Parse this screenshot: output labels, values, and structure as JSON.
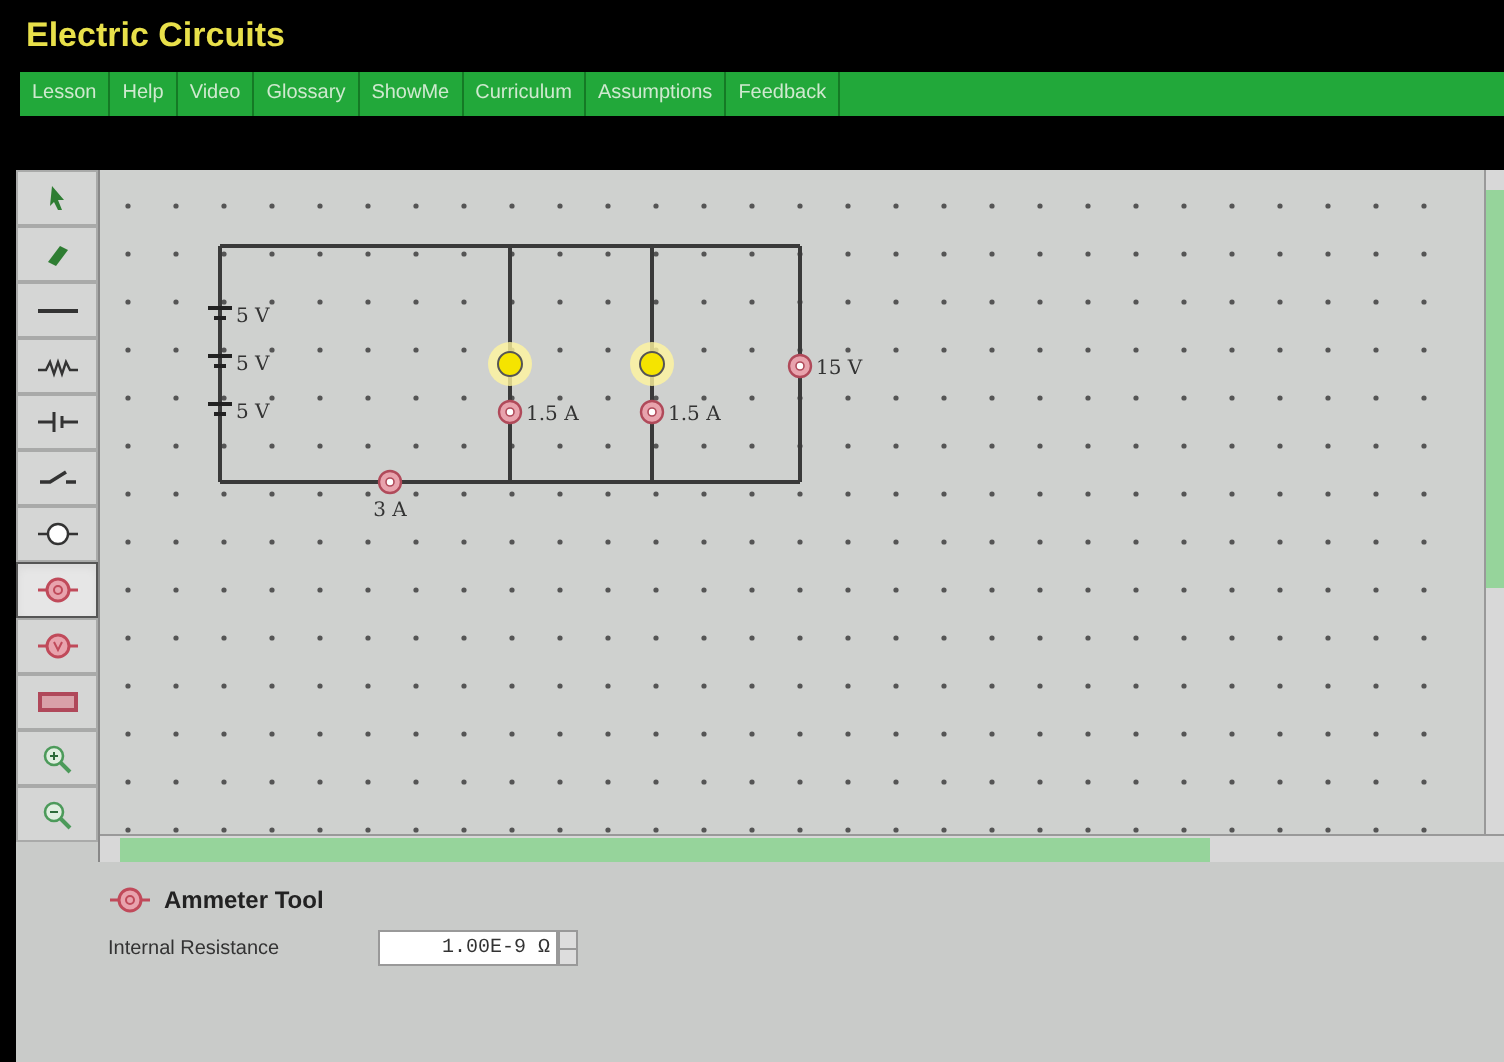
{
  "title": "Electric Circuits",
  "menu": [
    "Lesson",
    "Help",
    "Video",
    "Glossary",
    "ShowMe",
    "Curriculum",
    "Assumptions",
    "Feedback"
  ],
  "tools": [
    {
      "kind": "select",
      "selected": false
    },
    {
      "kind": "eraser",
      "selected": false
    },
    {
      "kind": "wire",
      "selected": false
    },
    {
      "kind": "resistor",
      "selected": false
    },
    {
      "kind": "battery",
      "selected": false
    },
    {
      "kind": "switch",
      "selected": false
    },
    {
      "kind": "bulb",
      "selected": false
    },
    {
      "kind": "ammeter",
      "selected": true
    },
    {
      "kind": "voltmeter",
      "selected": false
    },
    {
      "kind": "meter-block",
      "selected": false
    },
    {
      "kind": "zoom-in",
      "selected": false
    },
    {
      "kind": "zoom-out",
      "selected": false
    }
  ],
  "components": [
    {
      "kind": "battery",
      "reading": "5 V"
    },
    {
      "kind": "battery",
      "reading": "5 V"
    },
    {
      "kind": "battery",
      "reading": "5 V"
    },
    {
      "kind": "bulb",
      "lit": true
    },
    {
      "kind": "bulb",
      "lit": true
    },
    {
      "kind": "ammeter",
      "reading": "1.5 A"
    },
    {
      "kind": "ammeter",
      "reading": "1.5 A"
    },
    {
      "kind": "voltmeter",
      "reading": "15 V"
    },
    {
      "kind": "ammeter",
      "reading": "3 A"
    }
  ],
  "tool_panel": {
    "title": "Ammeter Tool",
    "field_label": "Internal Resistance",
    "field_value": "1.00E-9 Ω"
  }
}
